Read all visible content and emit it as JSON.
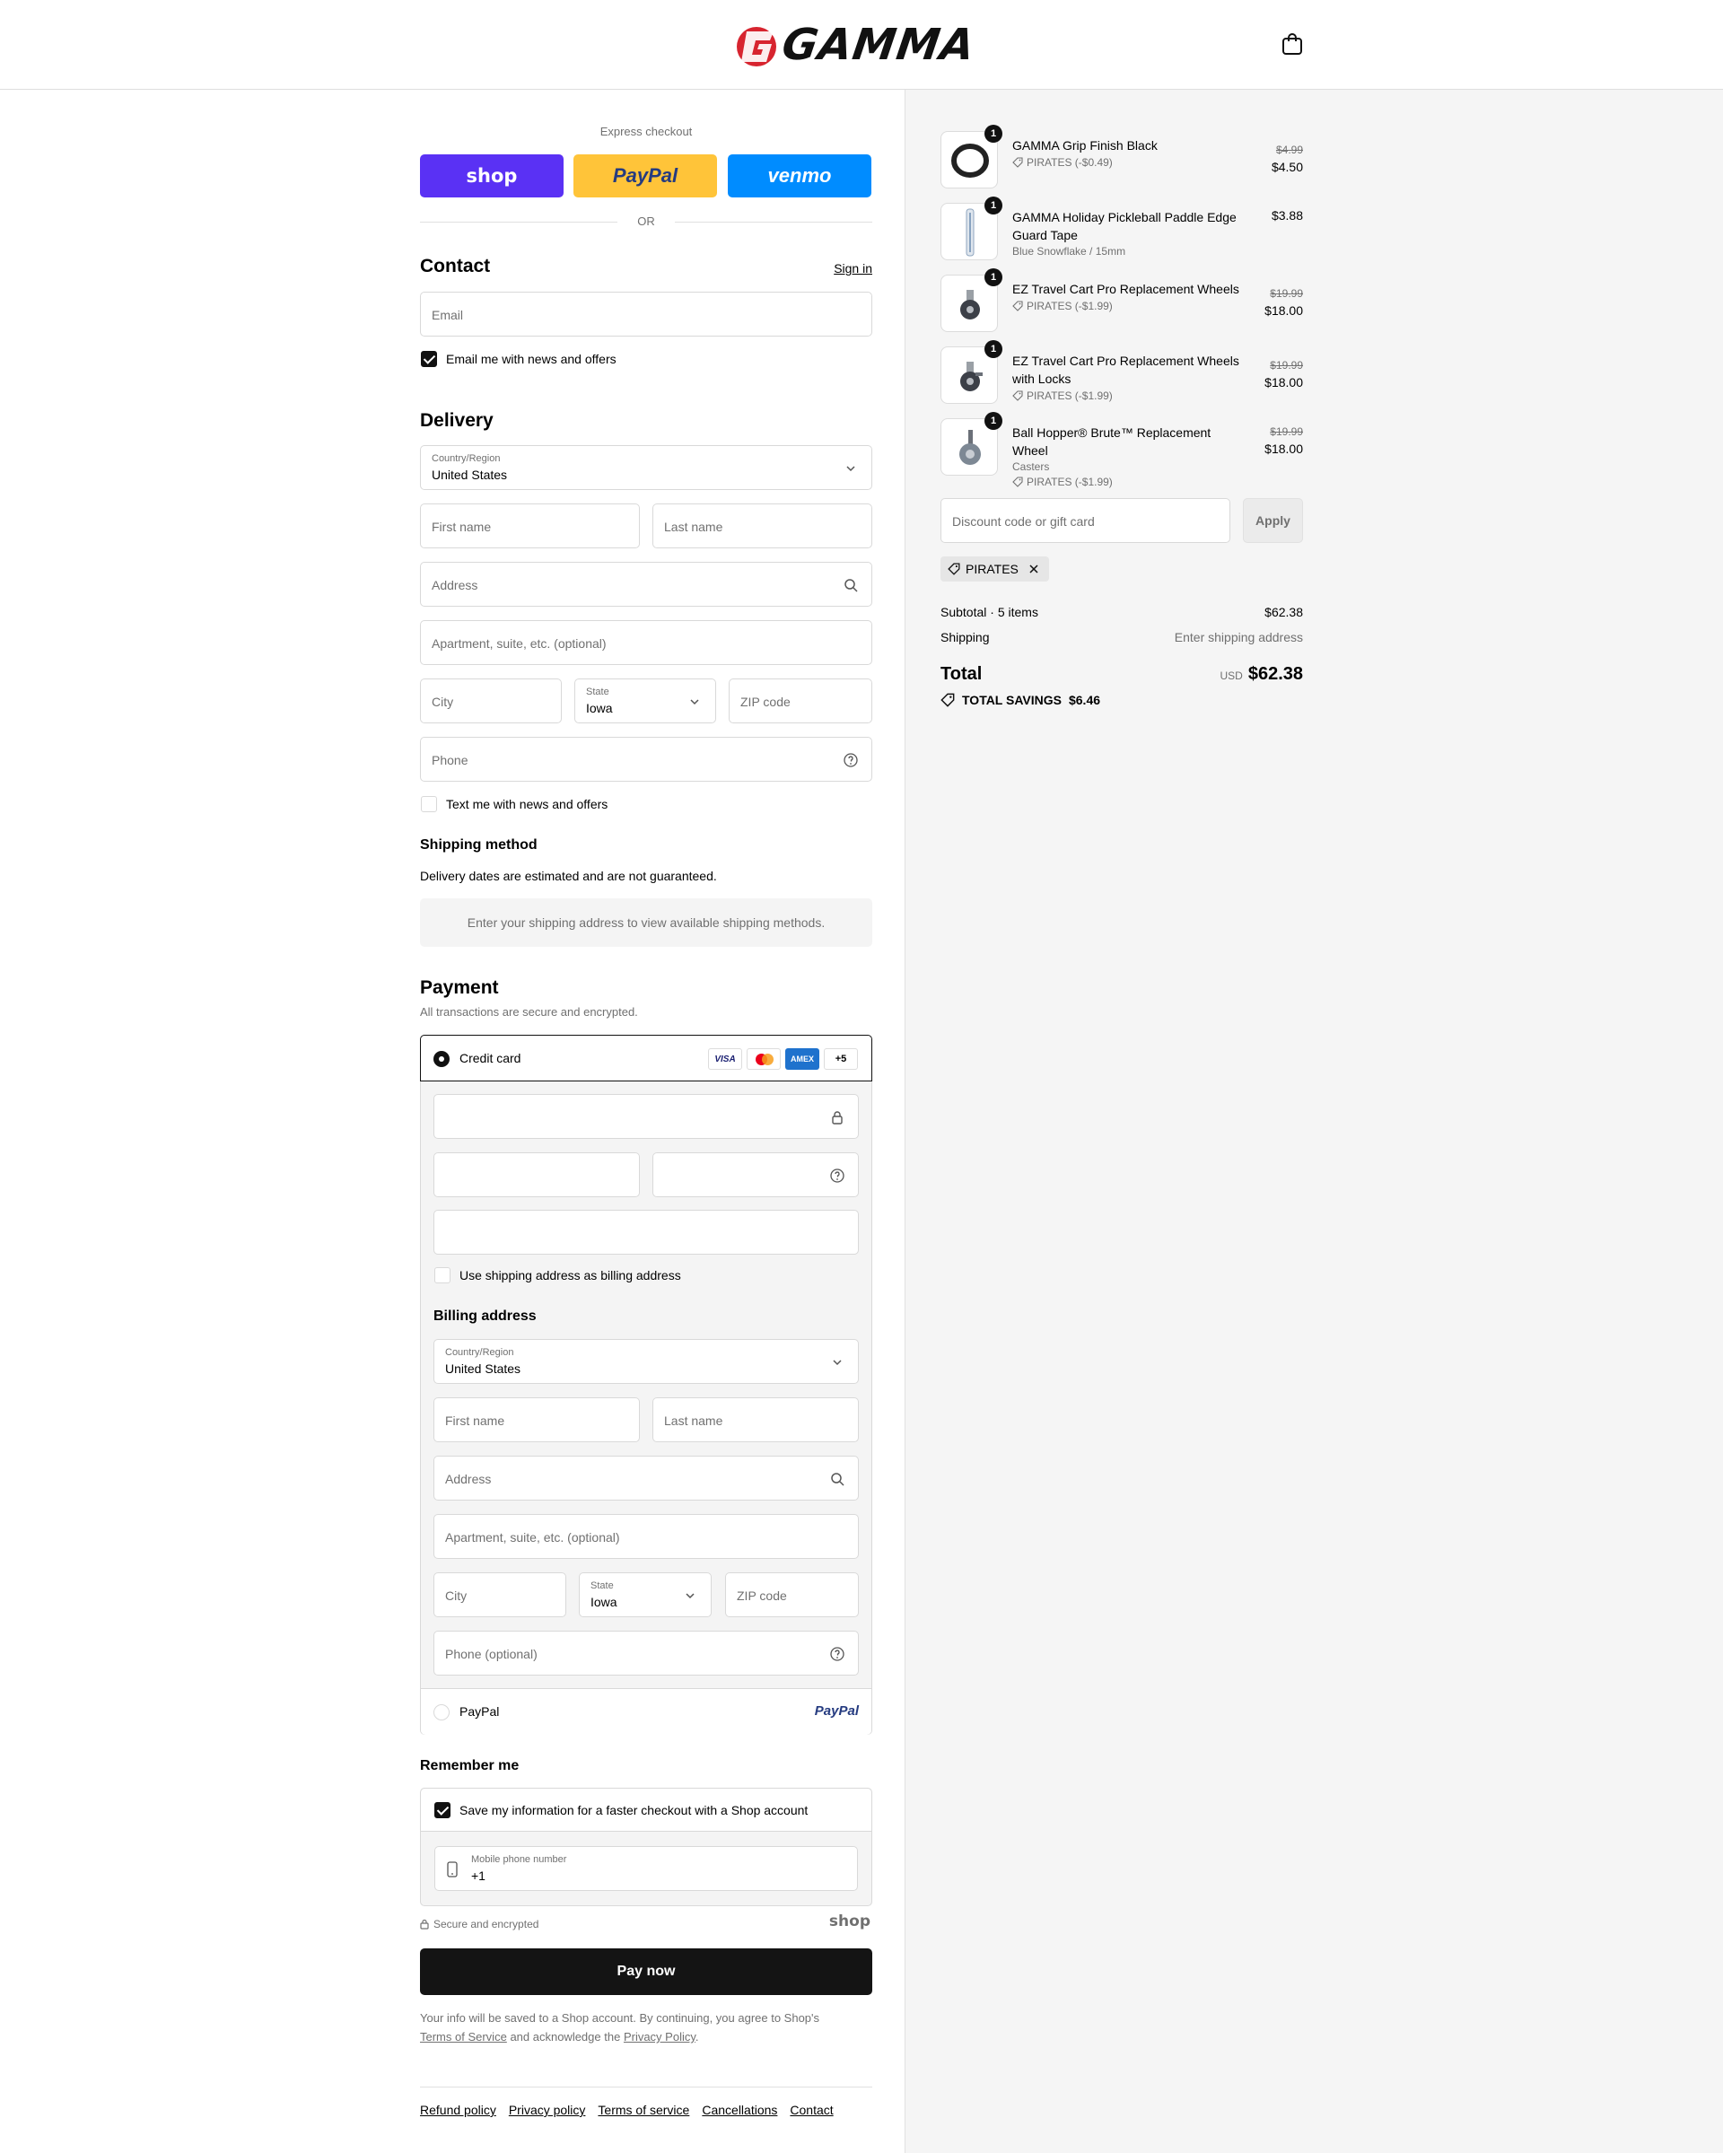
{
  "header": {
    "brand": "GAMMA",
    "cart_icon": "shopping-bag-icon"
  },
  "express": {
    "title": "Express checkout",
    "shop_label": "shop",
    "paypal_label": "PayPal",
    "venmo_label": "venmo",
    "or_label": "OR"
  },
  "contact": {
    "title": "Contact",
    "sign_in": "Sign in",
    "email_placeholder": "Email",
    "email_opt_in": "Email me with news and offers",
    "email_opt_in_checked": true
  },
  "delivery": {
    "title": "Delivery",
    "country_label": "Country/Region",
    "country_value": "United States",
    "first_name": "First name",
    "last_name": "Last name",
    "address": "Address",
    "apartment": "Apartment, suite, etc. (optional)",
    "city": "City",
    "state_label": "State",
    "state_value": "Iowa",
    "zip": "ZIP code",
    "phone": "Phone",
    "text_opt_in": "Text me with news and offers"
  },
  "shipping_method": {
    "title": "Shipping method",
    "note": "Delivery dates are estimated and are not guaranteed.",
    "placeholder": "Enter your shipping address to view available shipping methods."
  },
  "payment": {
    "title": "Payment",
    "subtitle": "All transactions are secure and encrypted.",
    "credit_card_label": "Credit card",
    "card_brands": [
      "VISA",
      "mastercard",
      "AMEX"
    ],
    "more_brands": "+5",
    "use_shipping_as_billing": "Use shipping address as billing address",
    "billing_title": "Billing address",
    "billing": {
      "country_label": "Country/Region",
      "country_value": "United States",
      "first_name": "First name",
      "last_name": "Last name",
      "address": "Address",
      "apartment": "Apartment, suite, etc. (optional)",
      "city": "City",
      "state_label": "State",
      "state_value": "Iowa",
      "zip": "ZIP code",
      "phone": "Phone (optional)"
    },
    "paypal_label": "PayPal",
    "paypal_logo": "PayPal"
  },
  "remember": {
    "title": "Remember me",
    "save_info": "Save my information for a faster checkout with a Shop account",
    "mobile_label": "Mobile phone number",
    "mobile_value": "+1",
    "secure": "Secure and encrypted",
    "shop": "shop"
  },
  "pay_now": "Pay now",
  "legal": {
    "pre": "Your info will be saved to a Shop account. By continuing, you agree to Shop's",
    "tos": "Terms of Service",
    "mid": "and acknowledge the",
    "privacy": "Privacy Policy",
    "end": "."
  },
  "footer_links": [
    "Refund policy",
    "Privacy policy",
    "Terms of service",
    "Cancellations",
    "Contact"
  ],
  "order": {
    "items": [
      {
        "name": "GAMMA Grip Finish Black",
        "qty": "1",
        "old_price": "$4.99",
        "price": "$4.50",
        "discount": "PIRATES (-$0.49)",
        "variant": ""
      },
      {
        "name": "GAMMA Holiday Pickleball Paddle Edge Guard Tape",
        "qty": "1",
        "old_price": "",
        "price": "$3.88",
        "discount": "",
        "variant": "Blue Snowflake / 15mm"
      },
      {
        "name": "EZ Travel Cart Pro Replacement Wheels",
        "qty": "1",
        "old_price": "$19.99",
        "price": "$18.00",
        "discount": "PIRATES (-$1.99)",
        "variant": ""
      },
      {
        "name": "EZ Travel Cart Pro Replacement Wheels with Locks",
        "qty": "1",
        "old_price": "$19.99",
        "price": "$18.00",
        "discount": "PIRATES (-$1.99)",
        "variant": ""
      },
      {
        "name": "Ball Hopper® Brute™ Replacement Wheel",
        "qty": "1",
        "old_price": "$19.99",
        "price": "$18.00",
        "discount": "PIRATES (-$1.99)",
        "variant": "Casters"
      }
    ],
    "discount_placeholder": "Discount code or gift card",
    "apply": "Apply",
    "applied_code": "PIRATES",
    "subtotal_label": "Subtotal · 5 items",
    "subtotal": "$62.38",
    "shipping_label": "Shipping",
    "shipping_value": "Enter shipping address",
    "total_label": "Total",
    "currency": "USD",
    "total": "$62.38",
    "savings_label": "TOTAL SAVINGS",
    "savings": "$6.46"
  }
}
